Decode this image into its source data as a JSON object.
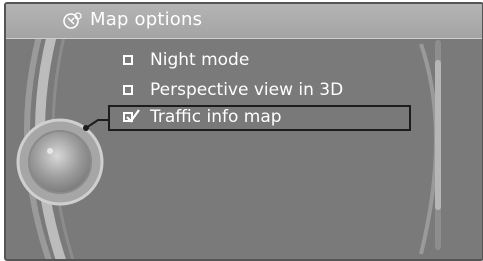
{
  "header": {
    "title": "Map options",
    "icon": "map-settings-icon"
  },
  "menu": {
    "items": [
      {
        "label": "Night mode",
        "checked": false,
        "selected": false
      },
      {
        "label": "Perspective view in 3D",
        "checked": false,
        "selected": false
      },
      {
        "label": "Traffic info map",
        "checked": true,
        "selected": true
      }
    ]
  },
  "colors": {
    "background": "#7a7a7a",
    "header": "#a8a8a8",
    "text": "#ffffff",
    "selection_border": "#1c1c1c"
  }
}
